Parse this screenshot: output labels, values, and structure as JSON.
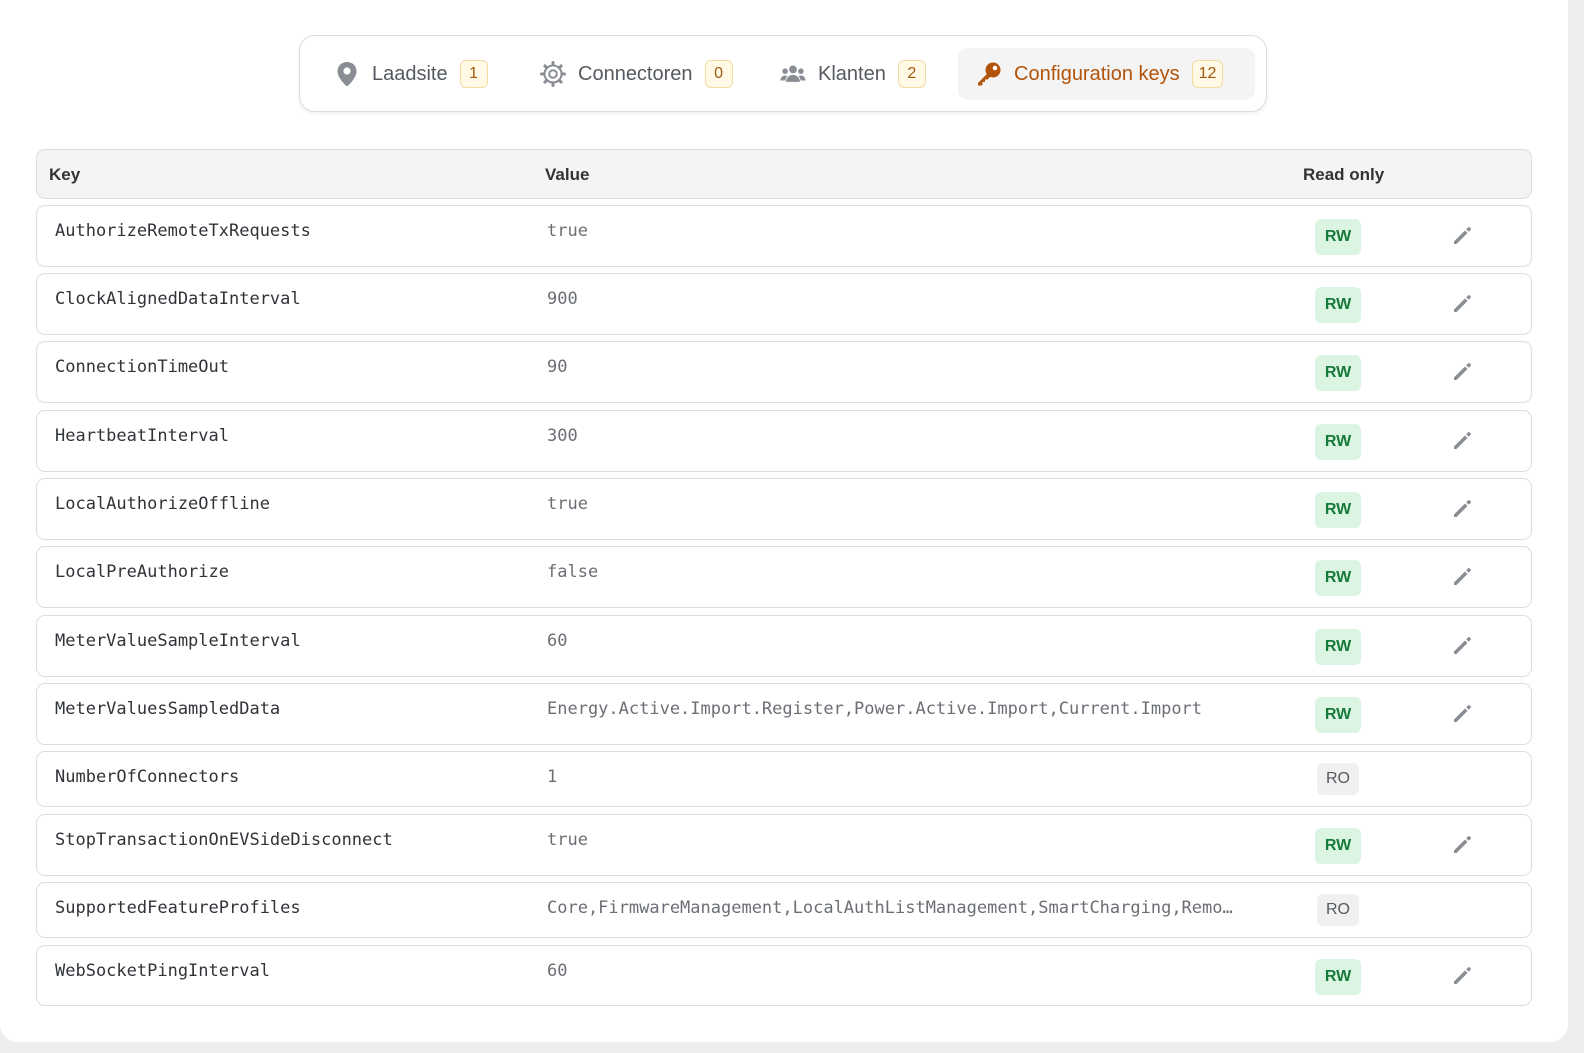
{
  "tabs": [
    {
      "label": "Laadsite",
      "count": "1",
      "icon": "location-pin-icon"
    },
    {
      "label": "Connectoren",
      "count": "0",
      "icon": "gear-icon"
    },
    {
      "label": "Klanten",
      "count": "2",
      "icon": "users-icon"
    },
    {
      "label": "Configuration keys",
      "count": "12",
      "icon": "key-icon"
    }
  ],
  "active_tab": "Configuration keys",
  "table": {
    "headers": {
      "key": "Key",
      "value": "Value",
      "read_only": "Read only"
    },
    "rows": [
      {
        "key": "AuthorizeRemoteTxRequests",
        "value": "true",
        "access": "RW"
      },
      {
        "key": "ClockAlignedDataInterval",
        "value": "900",
        "access": "RW"
      },
      {
        "key": "ConnectionTimeOut",
        "value": "90",
        "access": "RW"
      },
      {
        "key": "HeartbeatInterval",
        "value": "300",
        "access": "RW"
      },
      {
        "key": "LocalAuthorizeOffline",
        "value": "true",
        "access": "RW"
      },
      {
        "key": "LocalPreAuthorize",
        "value": "false",
        "access": "RW"
      },
      {
        "key": "MeterValueSampleInterval",
        "value": "60",
        "access": "RW"
      },
      {
        "key": "MeterValuesSampledData",
        "value": "Energy.Active.Import.Register,Power.Active.Import,Current.Import",
        "access": "RW"
      },
      {
        "key": "NumberOfConnectors",
        "value": "1",
        "access": "RO"
      },
      {
        "key": "StopTransactionOnEVSideDisconnect",
        "value": "true",
        "access": "RW"
      },
      {
        "key": "SupportedFeatureProfiles",
        "value": "Core,FirmwareManagement,LocalAuthListManagement,SmartCharging,Remo…",
        "access": "RO"
      },
      {
        "key": "WebSocketPingInterval",
        "value": "60",
        "access": "RW"
      }
    ]
  },
  "colors": {
    "accent": "#b35309",
    "rw_badge_bg": "#dcf5e3",
    "rw_badge_text": "#187a3a",
    "ro_badge_bg": "#f0f0f0",
    "count_badge_bg": "#fff9e6"
  }
}
